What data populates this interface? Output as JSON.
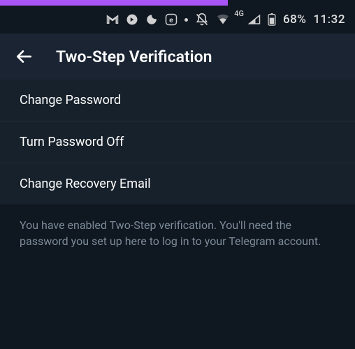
{
  "statusbar": {
    "networkLabel": "4G",
    "batteryPercent": "68%",
    "time": "11:32"
  },
  "header": {
    "title": "Two-Step Verification"
  },
  "menu": {
    "items": [
      {
        "label": "Change Password"
      },
      {
        "label": "Turn Password Off"
      },
      {
        "label": "Change Recovery Email"
      }
    ]
  },
  "info": {
    "text": "You have enabled Two-Step verification. You'll need the password you set up here to log in to your Telegram account."
  }
}
